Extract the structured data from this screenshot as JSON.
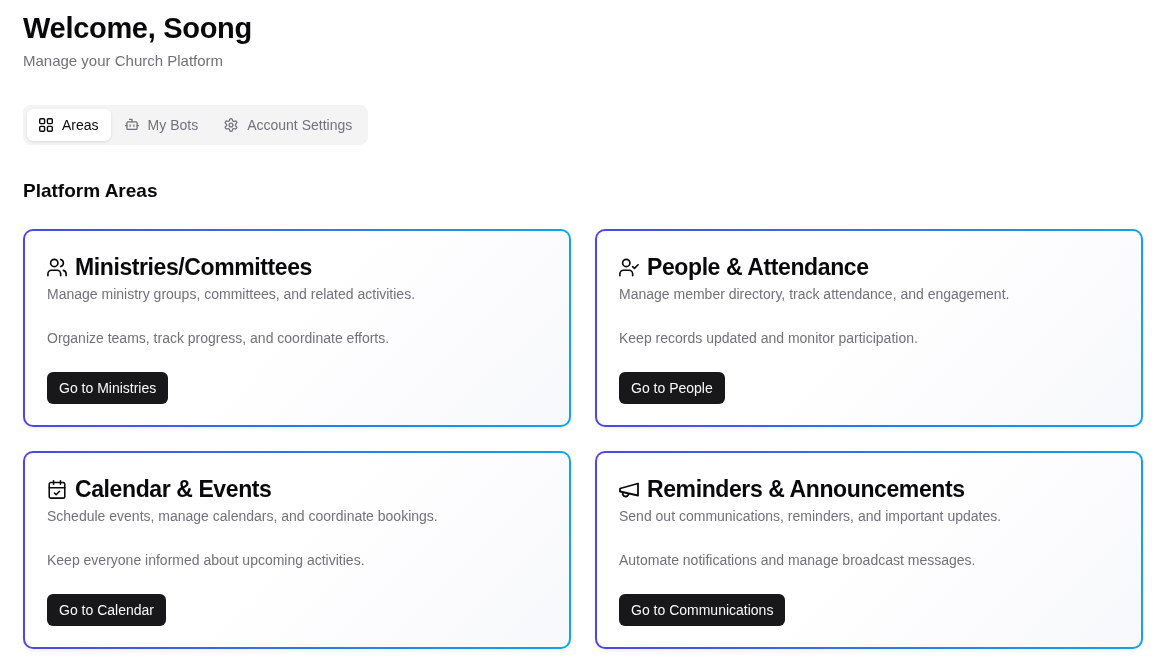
{
  "header": {
    "title": "Welcome, Soong",
    "subtitle": "Manage your Church Platform"
  },
  "tabs": [
    {
      "label": "Areas",
      "selected": true
    },
    {
      "label": "My Bots",
      "selected": false
    },
    {
      "label": "Account Settings",
      "selected": false
    }
  ],
  "section": {
    "title": "Platform Areas"
  },
  "cards": [
    {
      "title": "Ministries/Committees",
      "description": "Manage ministry groups, committees, and related activities.",
      "detail": "Organize teams, track progress, and coordinate efforts.",
      "button": "Go to Ministries"
    },
    {
      "title": "People & Attendance",
      "description": "Manage member directory, track attendance, and engagement.",
      "detail": "Keep records updated and monitor participation.",
      "button": "Go to People"
    },
    {
      "title": "Calendar & Events",
      "description": "Schedule events, manage calendars, and coordinate bookings.",
      "detail": "Keep everyone informed about upcoming activities.",
      "button": "Go to Calendar"
    },
    {
      "title": "Reminders & Announcements",
      "description": "Send out communications, reminders, and important updates.",
      "detail": "Automate notifications and manage broadcast messages.",
      "button": "Go to Communications"
    }
  ]
}
